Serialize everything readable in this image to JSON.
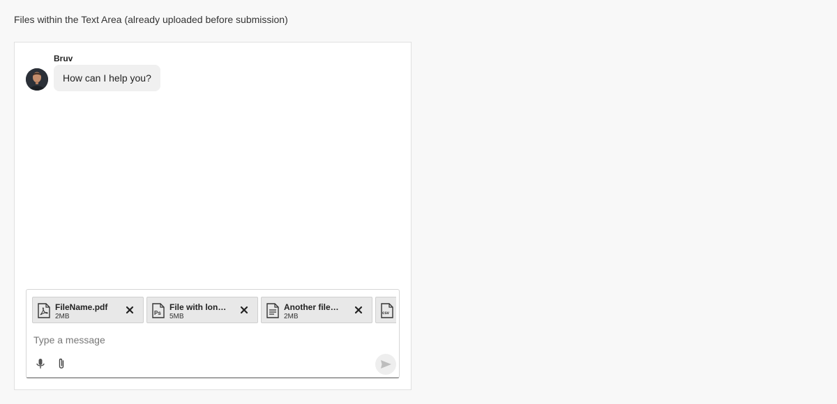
{
  "page": {
    "heading": "Files within the Text Area (already uploaded before submission)"
  },
  "chat": {
    "messages": [
      {
        "author": "Bruv",
        "text": "How can I help you?",
        "avatar": "avatar-photo"
      }
    ],
    "composer": {
      "placeholder": "Type a message",
      "value": "",
      "attachments": [
        {
          "name": "FileName.pdf",
          "size": "2MB",
          "icon": "pdf-file-icon"
        },
        {
          "name": "File with long name.psd",
          "size": "5MB",
          "icon": "psd-file-icon"
        },
        {
          "name": "Another file with long name.txt",
          "size": "2MB",
          "icon": "document-file-icon"
        },
        {
          "name": "",
          "size": "",
          "icon": "csv-file-icon"
        }
      ],
      "tools": [
        "microphone-icon",
        "paperclip-icon"
      ],
      "send_icon": "send-icon"
    }
  },
  "colors": {
    "page_bg": "#f8f8f8",
    "chip_bg": "#e8e8e8",
    "send_disabled": "#bdbdbd"
  }
}
